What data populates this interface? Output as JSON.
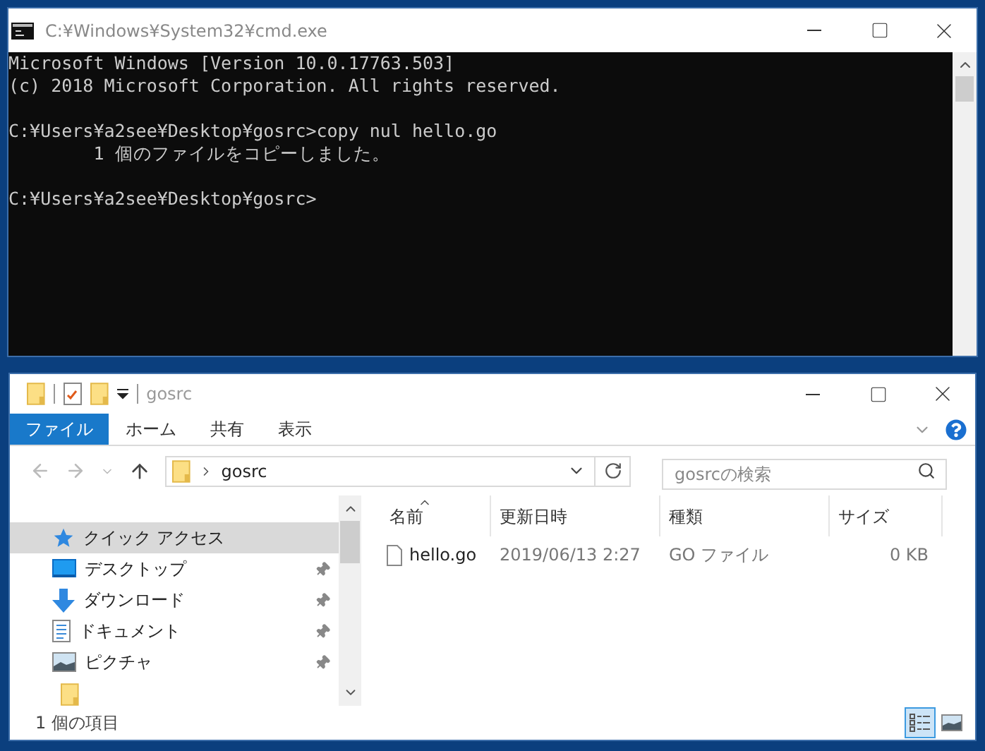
{
  "console_window": {
    "title": "C:¥Windows¥System32¥cmd.exe",
    "blocks": [
      [
        "Microsoft Windows [Version 10.0.17763.503]",
        "(c) 2018 Microsoft Corporation. All rights reserved."
      ],
      [
        "C:¥Users¥a2see¥Desktop¥gosrc>copy nul hello.go",
        "        1 個のファイルをコピーしました。"
      ],
      [
        "C:¥Users¥a2see¥Desktop¥gosrc>"
      ]
    ]
  },
  "explorer_window": {
    "title": "gosrc",
    "ribbon_tabs": [
      {
        "label": "ファイル",
        "selected": true
      },
      {
        "label": "ホーム",
        "selected": false
      },
      {
        "label": "共有",
        "selected": false
      },
      {
        "label": "表示",
        "selected": false
      }
    ],
    "address": "gosrc",
    "search": {
      "placeholder": "gosrcの検索"
    },
    "sidebar": [
      {
        "label": "クイック アクセス",
        "kind": "star",
        "selected": true,
        "pinned": false
      },
      {
        "label": "デスクトップ",
        "kind": "desktop",
        "selected": false,
        "pinned": true
      },
      {
        "label": "ダウンロード",
        "kind": "download",
        "selected": false,
        "pinned": true
      },
      {
        "label": "ドキュメント",
        "kind": "document",
        "selected": false,
        "pinned": true
      },
      {
        "label": "ピクチャ",
        "kind": "picture",
        "selected": false,
        "pinned": true
      }
    ],
    "columns": [
      {
        "label": "名前",
        "sorted": true
      },
      {
        "label": "更新日時",
        "sorted": false
      },
      {
        "label": "種類",
        "sorted": false
      },
      {
        "label": "サイズ",
        "sorted": false
      }
    ],
    "files": [
      {
        "name": "hello.go",
        "modified": "2019/06/13 2:27",
        "type": "GO ファイル",
        "size": "0 KB"
      }
    ],
    "status": "1 個の項目",
    "view_buttons": [
      {
        "kind": "details",
        "selected": true
      },
      {
        "kind": "large-icons",
        "selected": false
      }
    ]
  }
}
